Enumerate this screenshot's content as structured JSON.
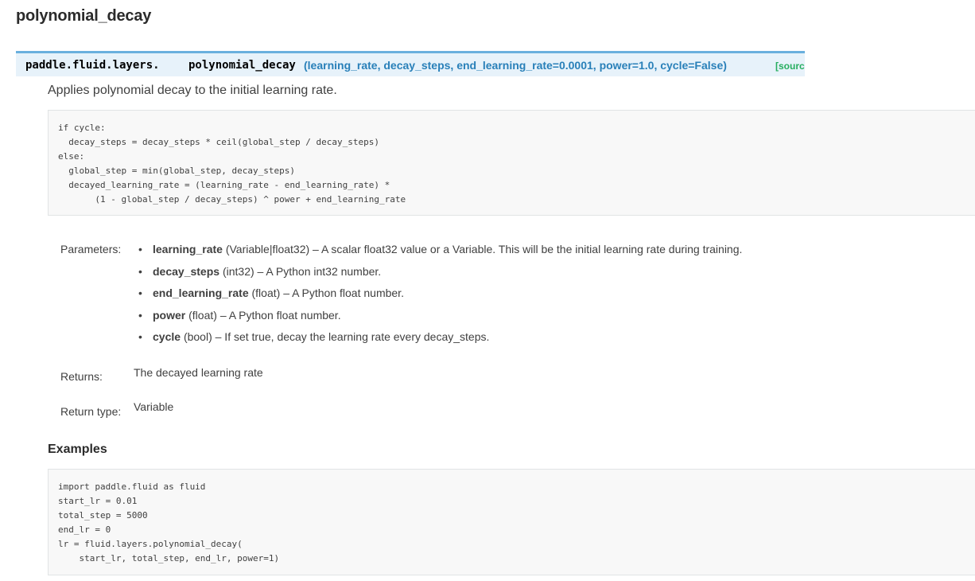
{
  "title": "polynomial_decay",
  "signature": {
    "prefix": "paddle.fluid.layers.",
    "name": "polynomial_decay",
    "params": "(learning_rate, decay_steps, end_learning_rate=0.0001, power=1.0, cycle=False)",
    "source_link": "[source]"
  },
  "description": "Applies polynomial decay to the initial learning rate.",
  "formula_code": [
    "if cycle:",
    "  decay_steps = decay_steps * ceil(global_step / decay_steps)",
    "else:",
    "  global_step = min(global_step, decay_steps)",
    "  decayed_learning_rate = (learning_rate - end_learning_rate) *",
    "       (1 - global_step / decay_steps) ^ power + end_learning_rate"
  ],
  "parameters": {
    "label": "Parameters:",
    "items": [
      {
        "name": "learning_rate",
        "type": "(Variable|float32)",
        "desc": "– A scalar float32 value or a Variable. This will be the initial learning rate during training."
      },
      {
        "name": "decay_steps",
        "type": "(int32)",
        "desc": "– A Python int32 number."
      },
      {
        "name": "end_learning_rate",
        "type": "(float)",
        "desc": "– A Python float number."
      },
      {
        "name": "power",
        "type": "(float)",
        "desc": "– A Python float number."
      },
      {
        "name": "cycle",
        "type": "(bool)",
        "desc": "– If set true, decay the learning rate every decay_steps."
      }
    ]
  },
  "returns": {
    "label": "Returns:",
    "value": "The decayed learning rate"
  },
  "return_type": {
    "label": "Return type:",
    "value": "Variable"
  },
  "examples": {
    "heading": "Examples",
    "code": [
      "import paddle.fluid as fluid",
      "start_lr = 0.01",
      "total_step = 5000",
      "end_lr = 0",
      "lr = fluid.layers.polynomial_decay(",
      "    start_lr, total_step, end_lr, power=1)"
    ]
  }
}
